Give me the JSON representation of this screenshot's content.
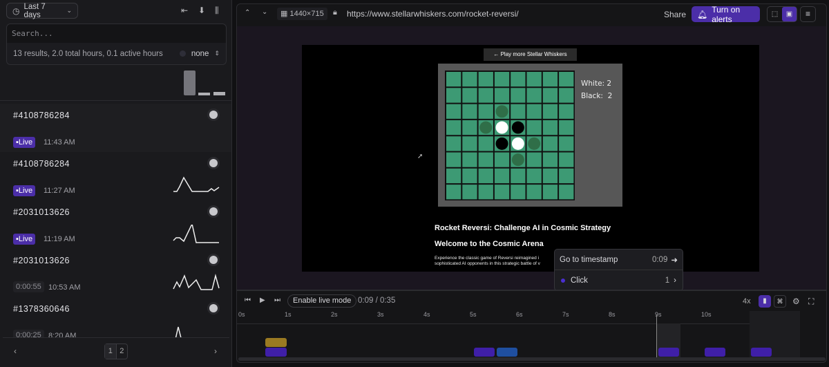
{
  "sidebar": {
    "date_range": "Last 7 days",
    "search_placeholder": "Search...",
    "stats": "13 results, 2.0 total hours, 0.1 active hours",
    "filter": "none",
    "sessions": [
      {
        "id": "#4108786284",
        "live": "Live",
        "time": "11:43 AM"
      },
      {
        "id": "#4108786284",
        "live": "Live",
        "time": "11:27 AM"
      },
      {
        "id": "#2031013626",
        "live": "Live",
        "time": "11:19 AM"
      },
      {
        "id": "#2031013626",
        "duration": "0:00:55",
        "time": "10:53 AM"
      },
      {
        "id": "#1378360646",
        "duration": "0:00:25",
        "time": "8:20 AM"
      }
    ],
    "pages": [
      "1",
      "2"
    ],
    "prev": "‹",
    "next": "›"
  },
  "toolbar": {
    "viewport": "1440×715",
    "url": "https://www.stellarwhiskers.com/rocket-reversi/",
    "share": "Share",
    "alerts": "Turn on alerts"
  },
  "game": {
    "back_link": "← Play more Stellar Whiskers Games!",
    "white": "White: 2",
    "black": "Black:  2",
    "title": "Rocket Reversi: Challenge AI in Cosmic Strategy",
    "subtitle": "Welcome to the Cosmic Arena",
    "para1": "Experience the classic game of Reversi reimagined i",
    "para2": "sophisticated AI opponents in this strategic battle of v"
  },
  "popup": {
    "goto": "Go to timestamp",
    "goto_time": "0:09",
    "event": "Click",
    "count": "1"
  },
  "player": {
    "live_mode": "Enable live mode",
    "time": "0:09 / 0:35",
    "speed": "4x",
    "ticks": [
      "0s",
      "1s",
      "2s",
      "3s",
      "4s",
      "5s",
      "6s",
      "7s",
      "8s",
      "9s",
      "10s"
    ]
  },
  "colors": {
    "accent": "#4b2ea8",
    "click": "#3f1fa8",
    "nav": "#1f4fa0",
    "warn": "#9a7a22"
  }
}
